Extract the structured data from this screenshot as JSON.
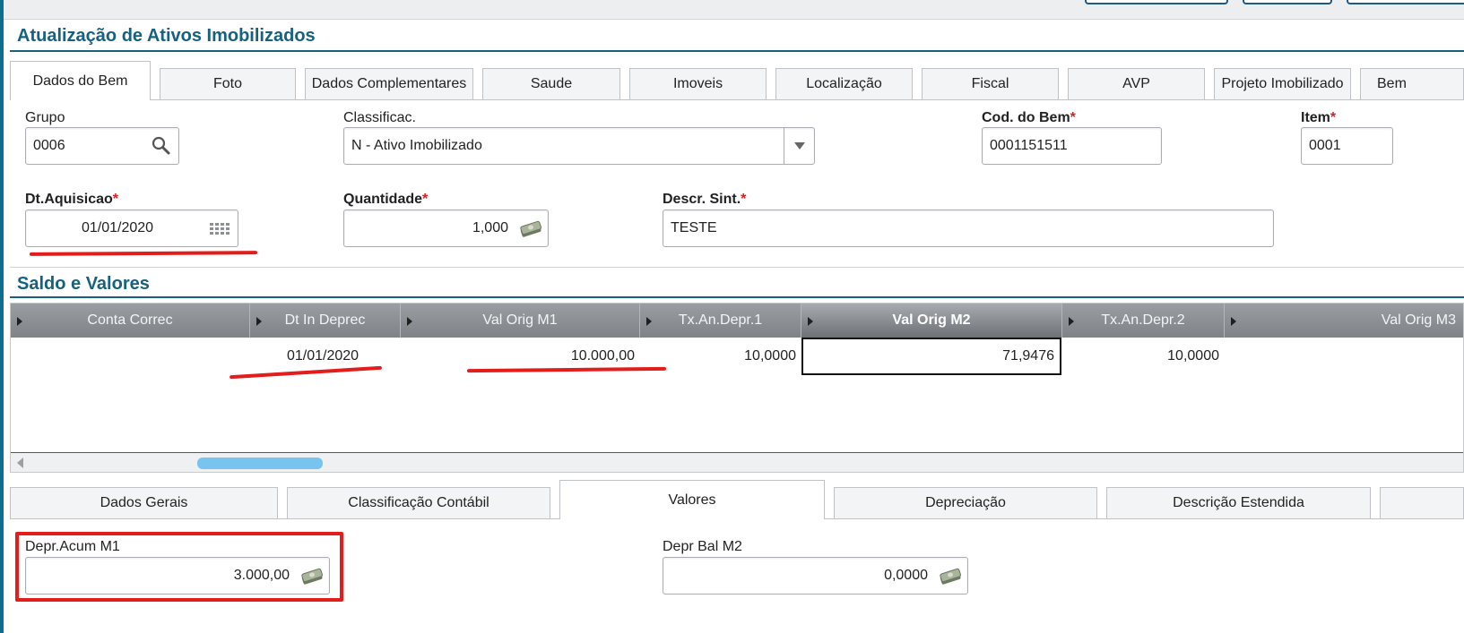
{
  "page_title": "Atualização de Ativos Imobilizados",
  "tabs": [
    {
      "label": "Dados do Bem",
      "active": true
    },
    {
      "label": "Foto"
    },
    {
      "label": "Dados Complementares"
    },
    {
      "label": "Saude"
    },
    {
      "label": "Imoveis"
    },
    {
      "label": "Localização"
    },
    {
      "label": "Fiscal"
    },
    {
      "label": "AVP"
    },
    {
      "label": "Projeto Imobilizado"
    },
    {
      "label": "Bem"
    }
  ],
  "fields": {
    "grupo": {
      "label": "Grupo",
      "value": "0006"
    },
    "classificac": {
      "label": "Classificac.",
      "value": "N - Ativo Imobilizado"
    },
    "cod_bem": {
      "label": "Cod. do Bem",
      "required": "*",
      "value": "0001151511"
    },
    "item": {
      "label": "Item",
      "required": "*",
      "value": "0001"
    },
    "dt_aquisicao": {
      "label": "Dt.Aquisicao",
      "required": "*",
      "value": "01/01/2020"
    },
    "quantidade": {
      "label": "Quantidade",
      "required": "*",
      "value": "1,000"
    },
    "descr_sint": {
      "label": "Descr. Sint.",
      "required": "*",
      "value": "TESTE"
    }
  },
  "saldo_title": "Saldo e Valores",
  "grid": {
    "columns": [
      "Conta Correc",
      "Dt In Deprec",
      "Val Orig M1",
      "Tx.An.Depr.1",
      "Val Orig M2",
      "Tx.An.Depr.2",
      "Val Orig M3"
    ],
    "selected_column": "Val Orig M2",
    "row": [
      "",
      "01/01/2020",
      "10.000,00",
      "10,0000",
      "71,9476",
      "10,0000",
      ""
    ]
  },
  "bottom_tabs": [
    {
      "label": "Dados Gerais"
    },
    {
      "label": "Classificação Contábil"
    },
    {
      "label": "Valores",
      "active": true
    },
    {
      "label": "Depreciação"
    },
    {
      "label": "Descrição Estendida"
    }
  ],
  "bottom_fields": {
    "depr_acum_m1": {
      "label": "Depr.Acum M1",
      "value": "3.000,00"
    },
    "depr_bal_m2": {
      "label": "Depr Bal M2",
      "value": "0,0000"
    }
  },
  "colors": {
    "accent": "#16617f",
    "annotation": "#e31c1c",
    "scroll_thumb": "#78c4ee"
  },
  "icons": [
    "search-icon",
    "dropdown-arrow-icon",
    "calendar-icon",
    "money-icon"
  ]
}
